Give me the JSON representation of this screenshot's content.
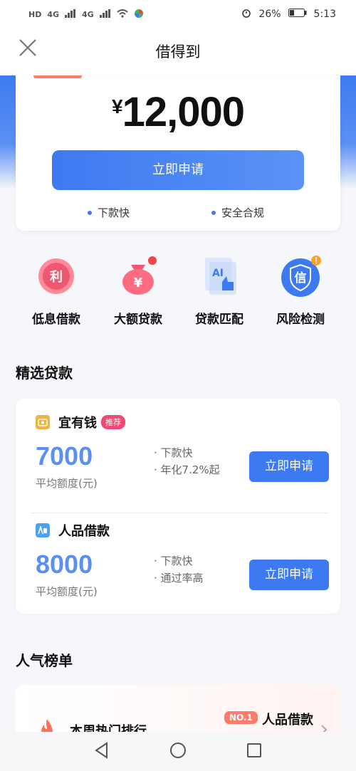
{
  "status_bar": {
    "hd": "HD",
    "net1": "4G",
    "net2": "4G",
    "battery_pct": "26%",
    "time": "5:13"
  },
  "nav": {
    "title": "借得到"
  },
  "hero": {
    "currency": "¥",
    "amount": "12,000",
    "apply_label": "立即申请",
    "features": [
      "下款快",
      "安全合规"
    ]
  },
  "quick_actions": [
    {
      "label": "低息借款",
      "icon": "li-char-icon",
      "glyph": "利"
    },
    {
      "label": "大额贷款",
      "icon": "money-bag-icon",
      "glyph": "¥"
    },
    {
      "label": "贷款匹配",
      "icon": "ai-match-icon",
      "glyph": "AI"
    },
    {
      "label": "风险检测",
      "icon": "credit-shield-icon",
      "glyph": "信"
    }
  ],
  "section_selected": {
    "title": "精选贷款"
  },
  "products": [
    {
      "name": "宜有钱",
      "badge": "推荐",
      "amount": "7000",
      "sub": "平均额度(元)",
      "points": [
        "· 下款快",
        "· 年化7.2%起"
      ],
      "button": "立即申请"
    },
    {
      "name": "人品借款",
      "badge": "",
      "amount": "8000",
      "sub": "平均额度(元)",
      "points": [
        "· 下款快",
        "· 通过率高"
      ],
      "button": "立即申请"
    }
  ],
  "section_popular": {
    "title": "人气榜单"
  },
  "ranking": {
    "title": "本周热门排行",
    "badge": "NO.1",
    "item": "人品借款"
  },
  "colors": {
    "accent": "#3d7af1",
    "amount": "#5b8ff1",
    "badge_pink": "#ef4a76",
    "no1": "#ff7c6d"
  }
}
